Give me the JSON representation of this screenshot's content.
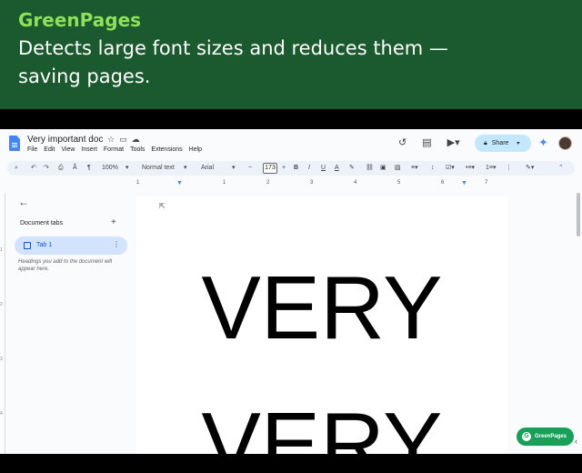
{
  "banner": {
    "title": "GreenPages",
    "subtitle": "Detects large font sizes and reduces them — saving pages."
  },
  "docs": {
    "title": "Very important doc",
    "title_icons": [
      "star-icon",
      "folder-move-icon",
      "cloud-status-icon"
    ],
    "menu": [
      "File",
      "Edit",
      "View",
      "Insert",
      "Format",
      "Tools",
      "Extensions",
      "Help"
    ],
    "share_label": "Share",
    "toolbar": {
      "zoom": "100%",
      "style": "Normal text",
      "font": "Arial",
      "font_size": "173",
      "minus": "−",
      "plus": "+"
    },
    "ruler_numbers": [
      "1",
      "1",
      "2",
      "3",
      "4",
      "5",
      "6",
      "7"
    ],
    "vruler_numbers": [
      "1",
      "2",
      "3",
      "4"
    ],
    "sidebar": {
      "tabs_title": "Document tabs",
      "tab_label": "Tab 1",
      "hint": "Headings you add to the document will appear here."
    },
    "page_text": [
      "VERY",
      "VERY"
    ],
    "extension_badge": "GreenPages"
  },
  "colors": {
    "banner_bg": "#1b5a2e",
    "banner_title": "#8fe05a",
    "share_bg": "#c2e7ff",
    "tab_active_bg": "#d3e3fd",
    "badge_bg": "#18a058"
  }
}
